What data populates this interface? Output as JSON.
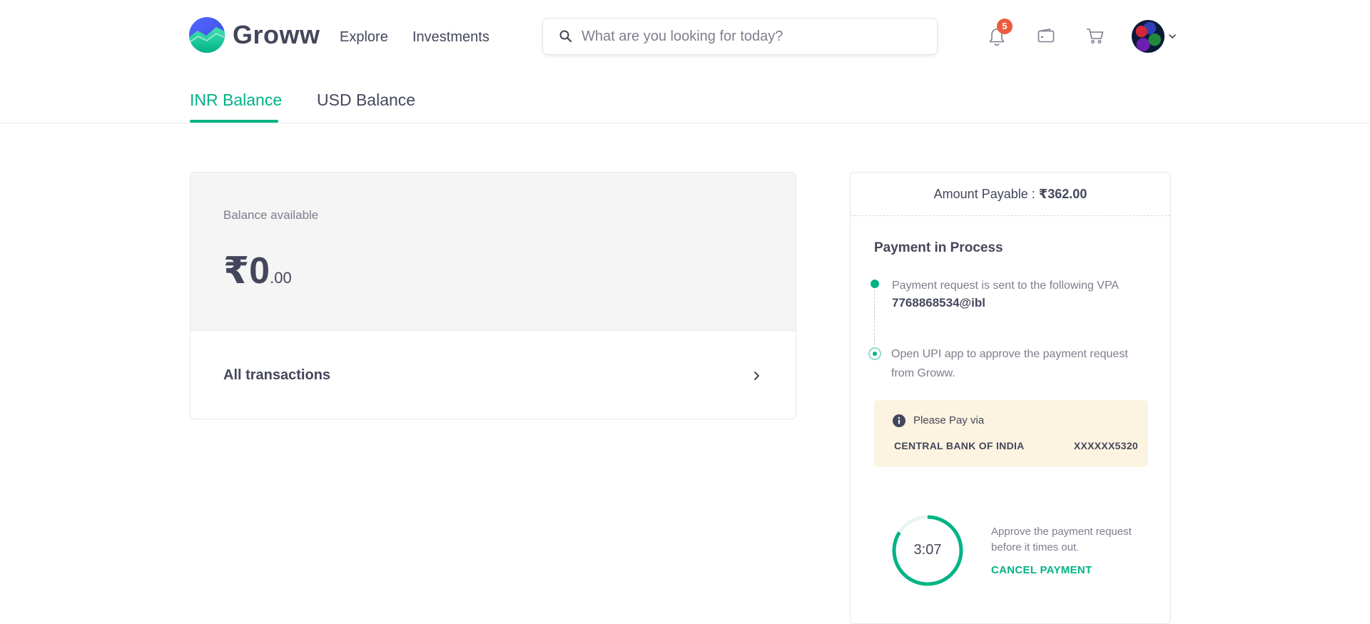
{
  "header": {
    "brand": "Groww",
    "nav": {
      "explore": "Explore",
      "investments": "Investments"
    },
    "search": {
      "placeholder": "What are you looking for today?",
      "value": ""
    },
    "notification_count": "5",
    "icons": [
      "search-icon",
      "bell-icon",
      "wallet-icon",
      "cart-icon",
      "chevron-down-icon"
    ]
  },
  "tabs": [
    {
      "label": "INR Balance",
      "active": true
    },
    {
      "label": "USD Balance",
      "active": false
    }
  ],
  "balance": {
    "label": "Balance available",
    "amount_main": "₹0",
    "amount_decimal": ".00",
    "all_transactions": "All transactions"
  },
  "payment": {
    "amount_label": "Amount Payable : ",
    "amount_value": "₹362.00",
    "title": "Payment in Process",
    "step1_text": "Payment request is sent to the following VPA",
    "vpa": "7768868534@ibl",
    "step2_text": "Open UPI app to approve the payment request from Groww.",
    "pay_via_title": "Please Pay via",
    "bank_name": "CENTRAL BANK OF INDIA",
    "account": "XXXXXX5320",
    "timer": "3:07",
    "timer_progress": 0.84,
    "approve_text": "Approve the payment request before it times out.",
    "cancel_label": "CANCEL PAYMENT"
  },
  "colors": {
    "brand_green": "#00b386",
    "text_dark": "#44475b",
    "text_muted": "#7c7e8c",
    "badge_red": "#eb5b3c",
    "pay_via_bg": "#fdf3e1"
  }
}
